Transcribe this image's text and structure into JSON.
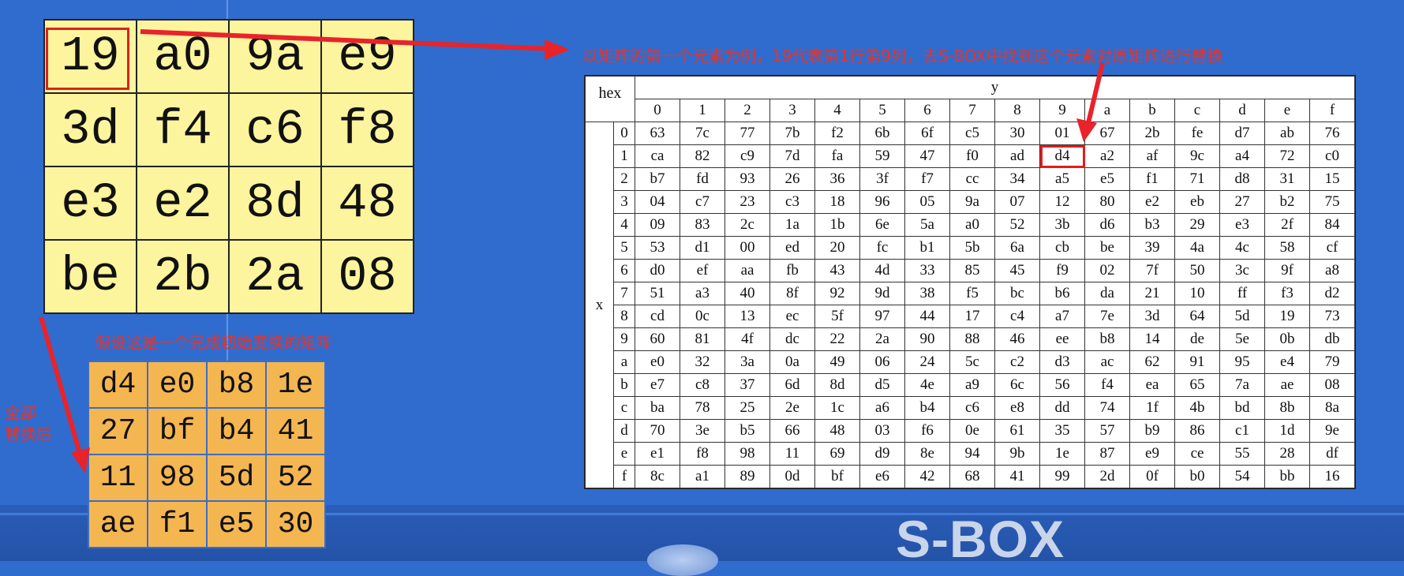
{
  "initial_matrix": [
    [
      "19",
      "a0",
      "9a",
      "e9"
    ],
    [
      "3d",
      "f4",
      "c6",
      "f8"
    ],
    [
      "e3",
      "e2",
      "8d",
      "48"
    ],
    [
      "be",
      "2b",
      "2a",
      "08"
    ]
  ],
  "result_matrix": [
    [
      "d4",
      "e0",
      "b8",
      "1e"
    ],
    [
      "27",
      "bf",
      "b4",
      "41"
    ],
    [
      "11",
      "98",
      "5d",
      "52"
    ],
    [
      "ae",
      "f1",
      "e5",
      "30"
    ]
  ],
  "notes": {
    "example": "以矩阵的第一个元素为例，19代表第1行第9列，去S-BOX中找到这个元素对原矩阵进行替换",
    "assumption": "假设这是一个完成初始变换的矩阵",
    "after_line1": "全部",
    "after_line2": "替换后"
  },
  "footer_title": "S-BOX",
  "sbox": {
    "corner": "hex",
    "col_axis": "y",
    "row_axis": "x",
    "col_headers": [
      "0",
      "1",
      "2",
      "3",
      "4",
      "5",
      "6",
      "7",
      "8",
      "9",
      "a",
      "b",
      "c",
      "d",
      "e",
      "f"
    ],
    "row_headers": [
      "0",
      "1",
      "2",
      "3",
      "4",
      "5",
      "6",
      "7",
      "8",
      "9",
      "a",
      "b",
      "c",
      "d",
      "e",
      "f"
    ],
    "rows": [
      [
        "63",
        "7c",
        "77",
        "7b",
        "f2",
        "6b",
        "6f",
        "c5",
        "30",
        "01",
        "67",
        "2b",
        "fe",
        "d7",
        "ab",
        "76"
      ],
      [
        "ca",
        "82",
        "c9",
        "7d",
        "fa",
        "59",
        "47",
        "f0",
        "ad",
        "d4",
        "a2",
        "af",
        "9c",
        "a4",
        "72",
        "c0"
      ],
      [
        "b7",
        "fd",
        "93",
        "26",
        "36",
        "3f",
        "f7",
        "cc",
        "34",
        "a5",
        "e5",
        "f1",
        "71",
        "d8",
        "31",
        "15"
      ],
      [
        "04",
        "c7",
        "23",
        "c3",
        "18",
        "96",
        "05",
        "9a",
        "07",
        "12",
        "80",
        "e2",
        "eb",
        "27",
        "b2",
        "75"
      ],
      [
        "09",
        "83",
        "2c",
        "1a",
        "1b",
        "6e",
        "5a",
        "a0",
        "52",
        "3b",
        "d6",
        "b3",
        "29",
        "e3",
        "2f",
        "84"
      ],
      [
        "53",
        "d1",
        "00",
        "ed",
        "20",
        "fc",
        "b1",
        "5b",
        "6a",
        "cb",
        "be",
        "39",
        "4a",
        "4c",
        "58",
        "cf"
      ],
      [
        "d0",
        "ef",
        "aa",
        "fb",
        "43",
        "4d",
        "33",
        "85",
        "45",
        "f9",
        "02",
        "7f",
        "50",
        "3c",
        "9f",
        "a8"
      ],
      [
        "51",
        "a3",
        "40",
        "8f",
        "92",
        "9d",
        "38",
        "f5",
        "bc",
        "b6",
        "da",
        "21",
        "10",
        "ff",
        "f3",
        "d2"
      ],
      [
        "cd",
        "0c",
        "13",
        "ec",
        "5f",
        "97",
        "44",
        "17",
        "c4",
        "a7",
        "7e",
        "3d",
        "64",
        "5d",
        "19",
        "73"
      ],
      [
        "60",
        "81",
        "4f",
        "dc",
        "22",
        "2a",
        "90",
        "88",
        "46",
        "ee",
        "b8",
        "14",
        "de",
        "5e",
        "0b",
        "db"
      ],
      [
        "e0",
        "32",
        "3a",
        "0a",
        "49",
        "06",
        "24",
        "5c",
        "c2",
        "d3",
        "ac",
        "62",
        "91",
        "95",
        "e4",
        "79"
      ],
      [
        "e7",
        "c8",
        "37",
        "6d",
        "8d",
        "d5",
        "4e",
        "a9",
        "6c",
        "56",
        "f4",
        "ea",
        "65",
        "7a",
        "ae",
        "08"
      ],
      [
        "ba",
        "78",
        "25",
        "2e",
        "1c",
        "a6",
        "b4",
        "c6",
        "e8",
        "dd",
        "74",
        "1f",
        "4b",
        "bd",
        "8b",
        "8a"
      ],
      [
        "70",
        "3e",
        "b5",
        "66",
        "48",
        "03",
        "f6",
        "0e",
        "61",
        "35",
        "57",
        "b9",
        "86",
        "c1",
        "1d",
        "9e"
      ],
      [
        "e1",
        "f8",
        "98",
        "11",
        "69",
        "d9",
        "8e",
        "94",
        "9b",
        "1e",
        "87",
        "e9",
        "ce",
        "55",
        "28",
        "df"
      ],
      [
        "8c",
        "a1",
        "89",
        "0d",
        "bf",
        "e6",
        "42",
        "68",
        "41",
        "99",
        "2d",
        "0f",
        "b0",
        "54",
        "bb",
        "16"
      ]
    ]
  },
  "colors": {
    "background": "#2f6ccd",
    "initial_cell": "#fdf49e",
    "result_cell": "#f4b651",
    "annotation_red": "#e8332b"
  }
}
